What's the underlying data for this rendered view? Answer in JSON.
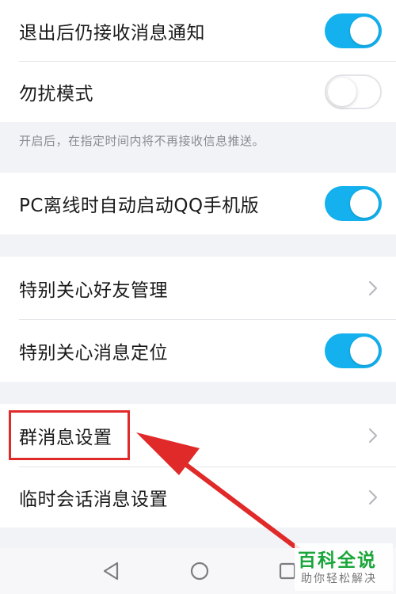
{
  "settings": {
    "rows": [
      {
        "label": "退出后仍接收消息通知",
        "control": "toggle",
        "state": "on"
      },
      {
        "label": "勿扰模式",
        "control": "toggle",
        "state": "off"
      },
      {
        "label": "PC离线时自动启动QQ手机版",
        "control": "toggle",
        "state": "on"
      },
      {
        "label": "特别关心好友管理",
        "control": "chevron"
      },
      {
        "label": "特别关心消息定位",
        "control": "toggle",
        "state": "on"
      },
      {
        "label": "群消息设置",
        "control": "chevron"
      },
      {
        "label": "临时会话消息设置",
        "control": "chevron"
      }
    ],
    "dnd_hint": "开启后，在指定时间内将不再接收信息推送。"
  },
  "navbar": {
    "icons": [
      "back-triangle-icon",
      "home-circle-icon",
      "recents-square-icon"
    ]
  },
  "watermark": {
    "title": "百科全说",
    "subtitle": "助你轻松解决"
  },
  "colors": {
    "toggle_on": "#14b1ee",
    "highlight": "#e02a2a",
    "watermark": "#1aa63a"
  }
}
